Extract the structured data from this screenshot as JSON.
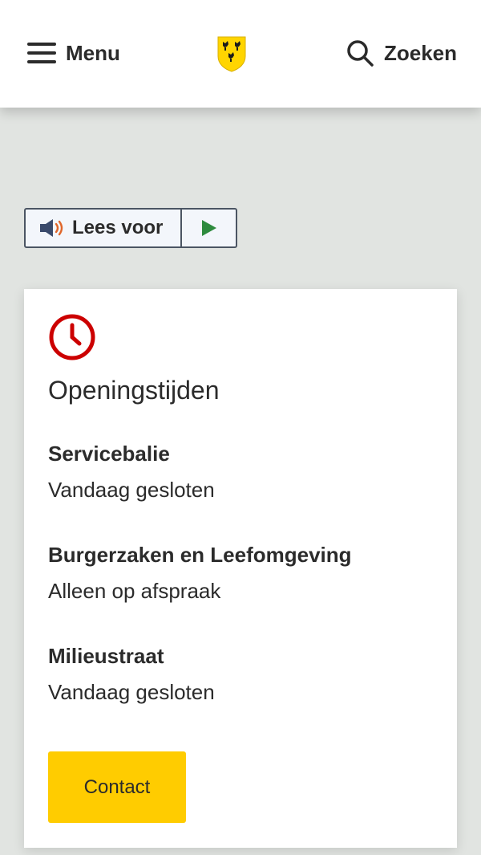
{
  "header": {
    "menu_label": "Menu",
    "search_label": "Zoeken"
  },
  "readspeaker": {
    "listen_label": "Lees voor"
  },
  "opening_hours": {
    "title": "Openingstijden",
    "items": [
      {
        "name": "Servicebalie",
        "status": "Vandaag gesloten"
      },
      {
        "name": "Burgerzaken en Leefomgeving",
        "status": "Alleen op afspraak"
      },
      {
        "name": "Milieustraat",
        "status": "Vandaag gesloten"
      }
    ],
    "contact_label": "Contact"
  },
  "colors": {
    "accent_yellow": "#ffcc00",
    "clock_red": "#cc0000",
    "play_green": "#2e8b3e",
    "background": "#e1e4e1"
  }
}
